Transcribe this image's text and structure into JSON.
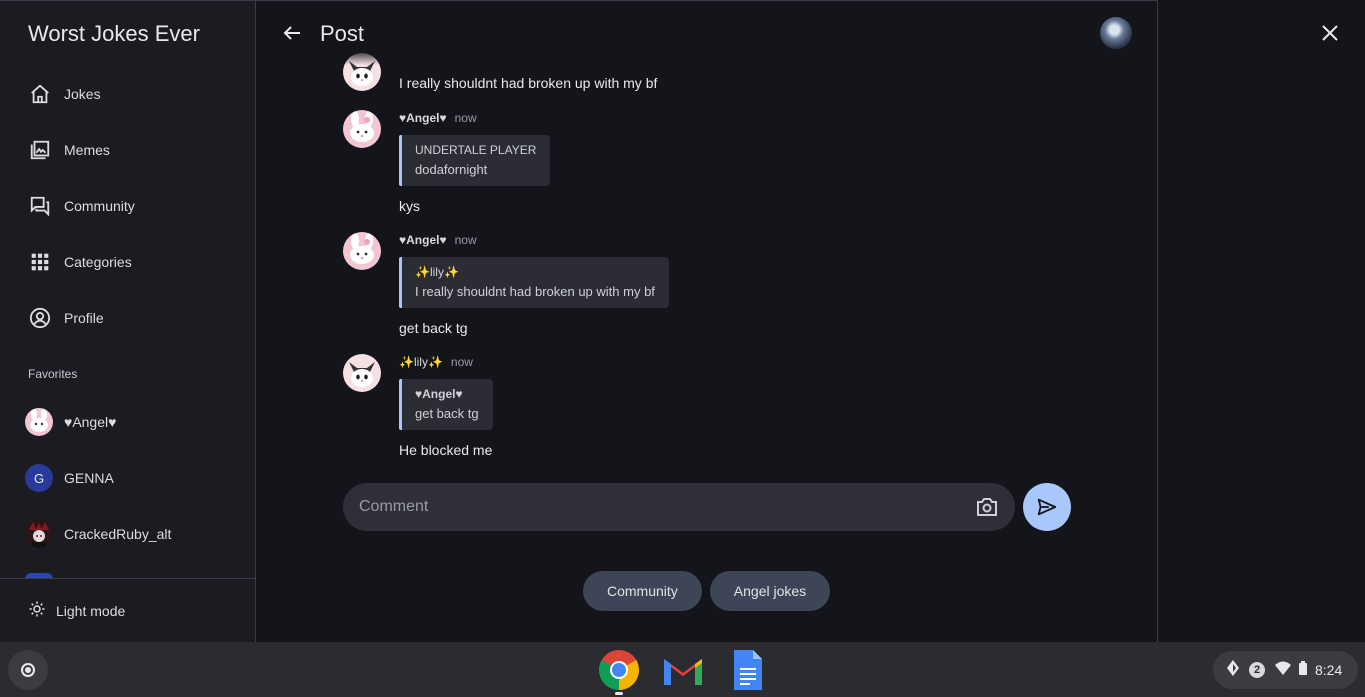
{
  "sidebar": {
    "app_title": "Worst Jokes Ever",
    "nav": [
      {
        "label": "Jokes",
        "icon": "home-icon"
      },
      {
        "label": "Memes",
        "icon": "gallery-icon"
      },
      {
        "label": "Community",
        "icon": "forum-icon"
      },
      {
        "label": "Categories",
        "icon": "grid-icon"
      },
      {
        "label": "Profile",
        "icon": "account-circle-icon"
      }
    ],
    "favorites_heading": "Favorites",
    "favorites": [
      {
        "label": "♥Angel♥",
        "avatar": "pink-bunny-avatar"
      },
      {
        "label": "GENNA",
        "avatar_letter": "G",
        "color": "#2a3a9a"
      },
      {
        "label": "CrackedRuby_alt",
        "avatar": "dark-character-avatar"
      }
    ],
    "footer_label": "Light mode"
  },
  "post": {
    "title": "Post",
    "comments": [
      {
        "body": "I really shouldnt had broken up with my bf"
      },
      {
        "author": "♥Angel♥",
        "time": "now",
        "quote_author": "UNDERTALE PLAYER",
        "quote_text": "dodafornight",
        "body": "kys"
      },
      {
        "author": "♥Angel♥",
        "time": "now",
        "quote_author": "✨lily✨",
        "quote_text": "I really shouldnt had broken up with my bf",
        "body": "get back tg"
      },
      {
        "author": "✨lily✨",
        "time": "now",
        "quote_author": "♥Angel♥",
        "quote_text": "get back tg",
        "body": "He blocked me"
      }
    ],
    "comment_placeholder": "Comment",
    "chips": [
      "Community",
      "Angel jokes"
    ]
  },
  "shelf": {
    "apps": [
      "Chrome",
      "Gmail",
      "Docs"
    ],
    "notification_count": "2",
    "time": "8:24"
  },
  "colors": {
    "accent": "#a8c7fa",
    "chip_bg": "#3e4556",
    "background": "#14151b"
  }
}
